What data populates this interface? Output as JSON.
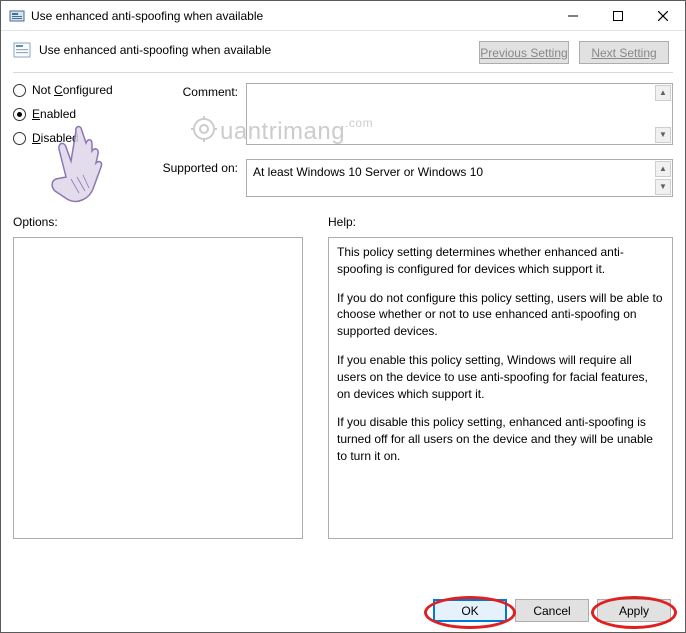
{
  "window": {
    "title": "Use enhanced anti-spoofing when available"
  },
  "header": {
    "title": "Use enhanced anti-spoofing when available",
    "prev_label": "Previous Setting",
    "next_label": "Next Setting"
  },
  "radios": {
    "not_configured": "Not Configured",
    "enabled": "Enabled",
    "disabled": "Disabled",
    "selected": "enabled"
  },
  "labels": {
    "comment": "Comment:",
    "supported": "Supported on:",
    "options": "Options:",
    "help": "Help:"
  },
  "fields": {
    "comment_value": "",
    "supported_value": "At least Windows 10 Server or Windows 10"
  },
  "help": {
    "p1": "This policy setting determines whether enhanced anti-spoofing is configured for devices which support it.",
    "p2": "If you do not configure this policy setting, users will be able to choose whether or not to use enhanced anti-spoofing on supported devices.",
    "p3": "If you enable this policy setting, Windows will require all users on the device to use anti-spoofing for facial features, on devices which support it.",
    "p4": "If you disable this policy setting, enhanced anti-spoofing is turned off for all users on the device and they will be unable to turn it on."
  },
  "buttons": {
    "ok": "OK",
    "cancel": "Cancel",
    "apply": "Apply"
  },
  "watermark": "uantrimang"
}
